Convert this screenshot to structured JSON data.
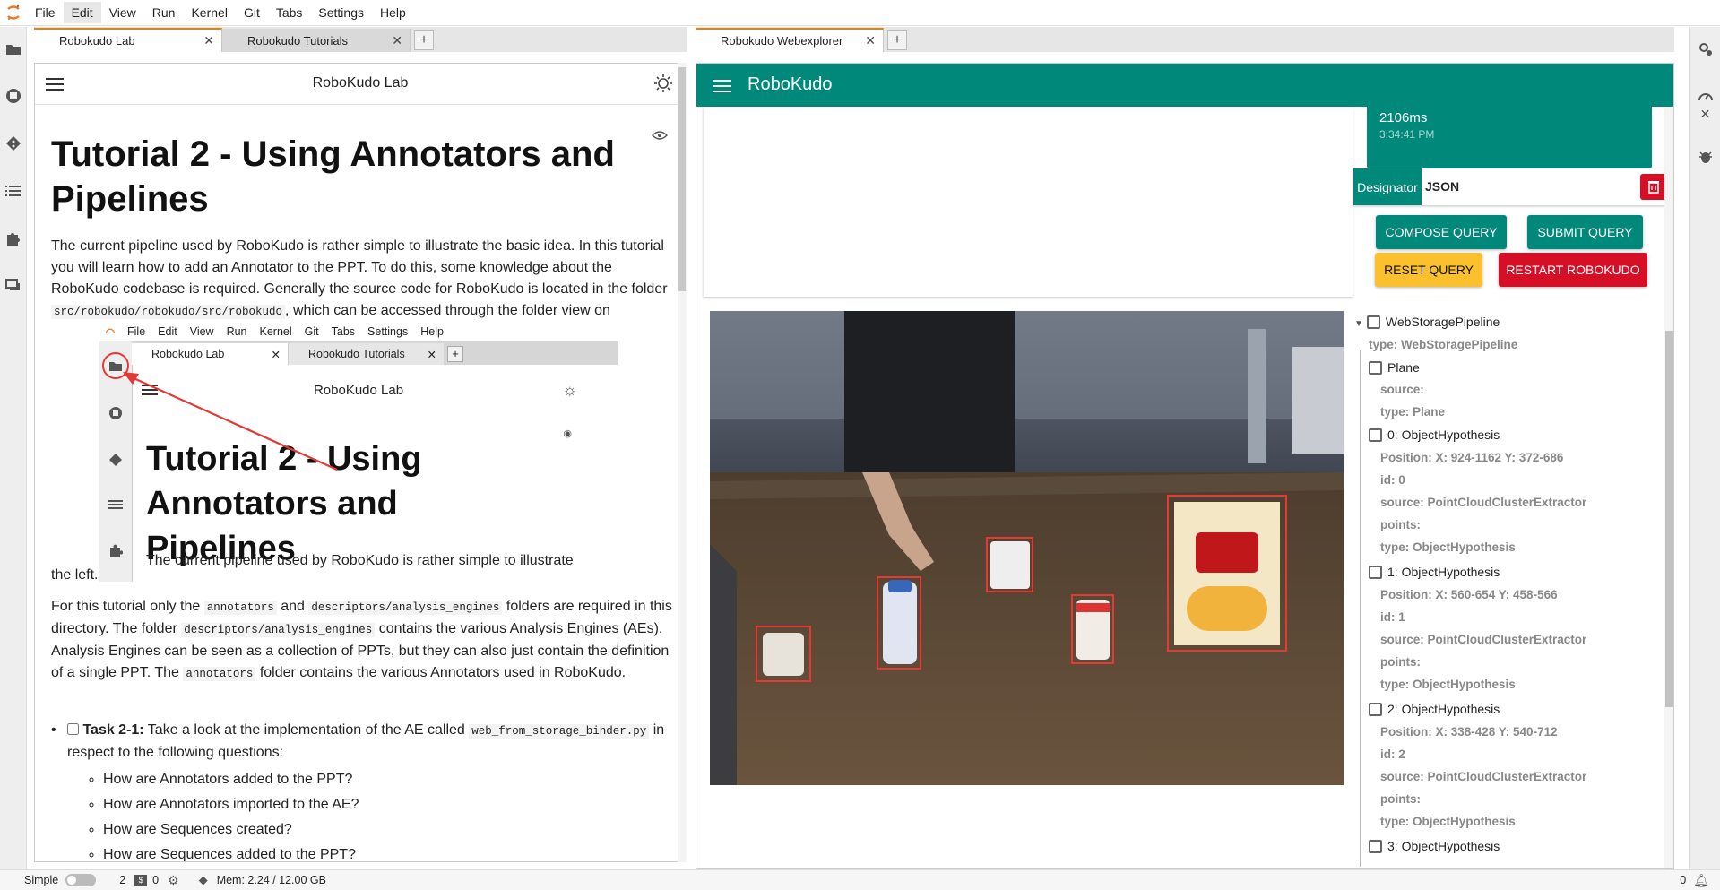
{
  "menubar": {
    "items": [
      "File",
      "Edit",
      "View",
      "Run",
      "Kernel",
      "Git",
      "Tabs",
      "Settings",
      "Help"
    ]
  },
  "left_tabs": [
    {
      "label": "Robokudo Lab",
      "active": true
    },
    {
      "label": "Robokudo Tutorials",
      "active": false
    }
  ],
  "right_tabs": [
    {
      "label": "Robokudo Webexplorer",
      "active": true
    }
  ],
  "notebook": {
    "title": "RoboKudo Lab",
    "heading": "Tutorial 2 - Using Annotators and Pipelines",
    "p1_a": "The current pipeline used by RoboKudo is rather simple to illustrate the basic idea. In this tutorial you will learn how to add an Annotator to the PPT. To do this, some knowledge about the RoboKudo codebase is required. Generally the source code for RoboKudo is located in the folder",
    "p1_code": "src/robokudo/robokudo/src/robokudo",
    "p1_b": ", which can be accessed through the folder view on",
    "p1_end": "the left.",
    "p2_a": "For this tutorial only the",
    "p2_code1": "annotators",
    "p2_and": "and",
    "p2_code2": "descriptors/analysis_engines",
    "p2_b": "folders are required in this directory. The folder",
    "p2_code3": "descriptors/analysis_engines",
    "p2_c": "contains the various Analysis Engines (AEs). Analysis Engines can be seen as a collection of PPTs, but they can also just contain the definition of a single PPT. The",
    "p2_code4": "annotators",
    "p2_d": "folder contains the various Annotators used in RoboKudo.",
    "task_label": "Task 2-1:",
    "task_text": "Take a look at the implementation of the AE called",
    "task_code": "web_from_storage_binder.py",
    "task_text2": "in respect to the following questions:",
    "questions": [
      "How are Annotators added to the PPT?",
      "How are Annotators imported to the AE?",
      "How are Sequences created?",
      "How are Sequences added to the PPT?"
    ],
    "embedded": {
      "menu": [
        "File",
        "Edit",
        "View",
        "Run",
        "Kernel",
        "Git",
        "Tabs",
        "Settings",
        "Help"
      ],
      "tabs": [
        "Robokudo Lab",
        "Robokudo Tutorials"
      ],
      "title": "RoboKudo Lab",
      "heading": "Tutorial 2 - Using Annotators and Pipelines",
      "text": "The current pipeline used by RoboKudo is rather simple to illustrate"
    }
  },
  "webexplorer": {
    "app_title": "RoboKudo",
    "message": {
      "text": "2106ms",
      "time": "3:34:41 PM"
    },
    "designator_label": "Designator",
    "designator_value": "JSON",
    "buttons": {
      "compose": "COMPOSE QUERY",
      "submit": "SUBMIT QUERY",
      "reset": "RESET QUERY",
      "restart": "RESTART ROBOKUDO"
    },
    "tree": {
      "root": "WebStoragePipeline",
      "root_type": "type: WebStoragePipeline",
      "nodes": [
        {
          "name": "Plane",
          "props": [
            "source:",
            "type: Plane"
          ]
        },
        {
          "name": "0: ObjectHypothesis",
          "props": [
            "Position: X: 924-1162 Y: 372-686",
            "id: 0",
            "source: PointCloudClusterExtractor",
            "points:",
            "type: ObjectHypothesis"
          ]
        },
        {
          "name": "1: ObjectHypothesis",
          "props": [
            "Position: X: 560-654 Y: 458-566",
            "id: 1",
            "source: PointCloudClusterExtractor",
            "points:",
            "type: ObjectHypothesis"
          ]
        },
        {
          "name": "2: ObjectHypothesis",
          "props": [
            "Position: X: 338-428 Y: 540-712",
            "id: 2",
            "source: PointCloudClusterExtractor",
            "points:",
            "type: ObjectHypothesis"
          ]
        },
        {
          "name": "3: ObjectHypothesis",
          "props": []
        }
      ]
    }
  },
  "statusbar": {
    "mode": "Simple",
    "kernels": "2",
    "terminals": "0",
    "memory": "Mem: 2.24 / 12.00 GB",
    "notifications": "0"
  },
  "colors": {
    "teal": "#00897b",
    "amber": "#fbc02d",
    "red": "#d50f25",
    "accent": "#f57c00"
  }
}
